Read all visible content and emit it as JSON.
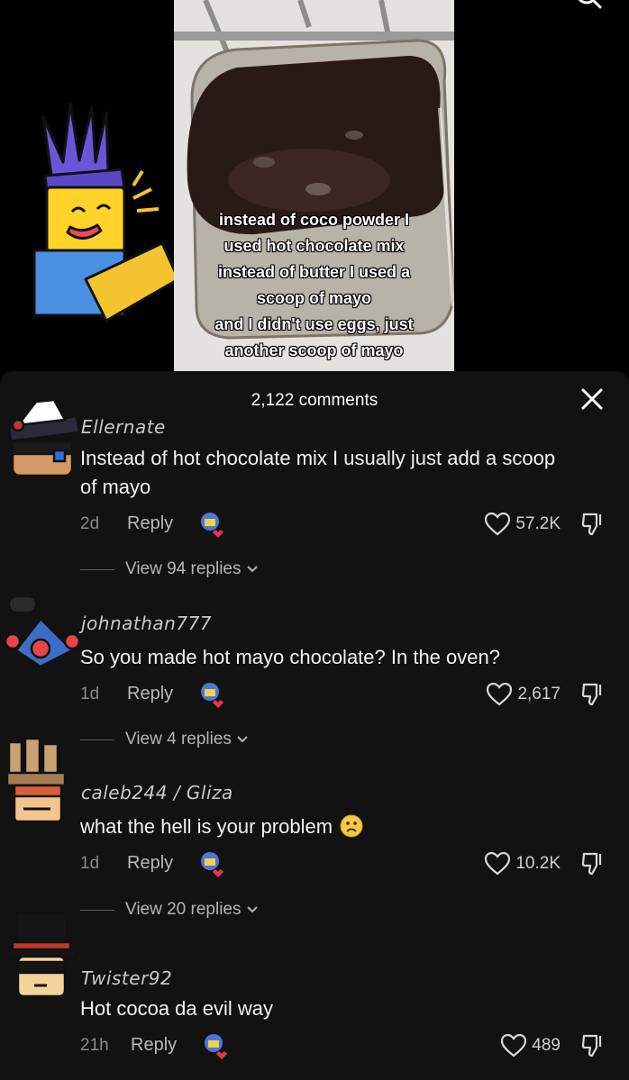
{
  "video": {
    "caption_lines": [
      "instead of coco powder I",
      "used hot chocolate mix",
      "instead of butter I used a",
      "scoop of mayo",
      "and I didn't use eggs, just",
      "another scoop of mayo"
    ]
  },
  "sheet": {
    "title": "2,122 comments"
  },
  "comments": [
    {
      "username": "Ellernate",
      "text": "Instead of hot chocolate mix I usually just add a scoop of mayo",
      "time": "2d",
      "reply_label": "Reply",
      "likes": "57.2K",
      "view_replies": "View 94 replies"
    },
    {
      "username": "johnathan777",
      "text": "So you made hot mayo chocolate? In the oven?",
      "time": "1d",
      "reply_label": "Reply",
      "likes": "2,617",
      "view_replies": "View 4 replies"
    },
    {
      "username": "caleb244 / Gliza",
      "text": "what the hell is your problem",
      "time": "1d",
      "reply_label": "Reply",
      "likes": "10.2K",
      "view_replies": "View 20 replies"
    },
    {
      "username": "Twister92",
      "text": "Hot cocoa da evil way",
      "time": "21h",
      "reply_label": "Reply",
      "likes": "489"
    }
  ],
  "icons": {
    "search": "search-icon",
    "close": "close-icon",
    "heart": "heart-icon",
    "dislike": "dislike-icon",
    "chevron": "chevron-down-icon",
    "frown": "frowning-face-emoji"
  },
  "colors": {
    "sheet_bg": "#121212",
    "text": "#f2f2f2",
    "muted": "#8a8a8a"
  }
}
